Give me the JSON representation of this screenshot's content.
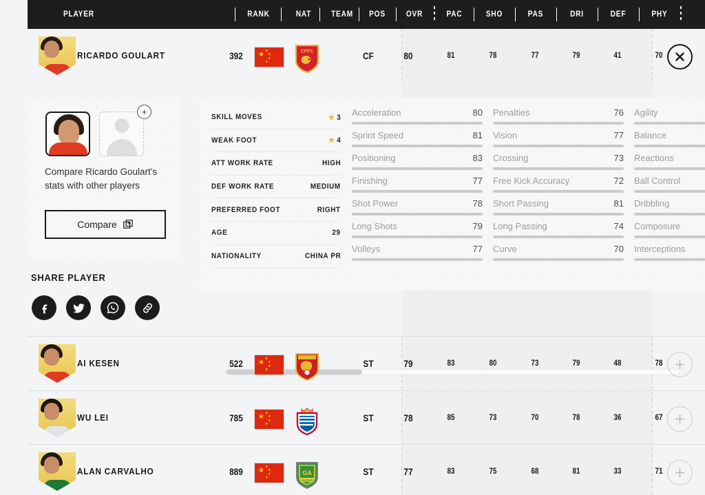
{
  "table": {
    "columns": [
      {
        "key": "player",
        "label": "PLAYER"
      },
      {
        "key": "rank",
        "label": "RANK"
      },
      {
        "key": "nat",
        "label": "NAT"
      },
      {
        "key": "team",
        "label": "TEAM"
      },
      {
        "key": "pos",
        "label": "POS"
      },
      {
        "key": "ovr",
        "label": "OVR"
      },
      {
        "key": "pac",
        "label": "PAC"
      },
      {
        "key": "sho",
        "label": "SHO"
      },
      {
        "key": "pas",
        "label": "PAS"
      },
      {
        "key": "dri",
        "label": "DRI"
      },
      {
        "key": "def",
        "label": "DEF"
      },
      {
        "key": "phy",
        "label": "PHY"
      }
    ]
  },
  "selected_player": {
    "name": "RICARDO GOULART",
    "rank": "392",
    "nation": "China PR",
    "nation_flag": "china-flag",
    "team": "Hebei CFFC",
    "team_badge": "hebei-cffc-badge",
    "pos": "CF",
    "ovr": "80",
    "pac": "81",
    "sho": "78",
    "pas": "77",
    "dri": "79",
    "def": "41",
    "phy": "70",
    "close_label": "✕"
  },
  "detail": {
    "compare_card": {
      "description": "Compare Ricardo Goulart's stats with other players",
      "button_label": "Compare",
      "add_slot_label": "+"
    },
    "share": {
      "title": "SHARE PLAYER",
      "icons": [
        {
          "name": "facebook-icon",
          "glyph": "f"
        },
        {
          "name": "twitter-icon",
          "glyph": "t"
        },
        {
          "name": "whatsapp-icon",
          "glyph": "w"
        },
        {
          "name": "copy-link-icon",
          "glyph": "l"
        }
      ]
    },
    "info_rows": [
      {
        "label": "SKILL MOVES",
        "value": "3",
        "star": true
      },
      {
        "label": "WEAK FOOT",
        "value": "4",
        "star": true
      },
      {
        "label": "ATT WORK RATE",
        "value": "HIGH",
        "star": false
      },
      {
        "label": "DEF WORK RATE",
        "value": "MEDIUM",
        "star": false
      },
      {
        "label": "PREFERRED FOOT",
        "value": "RIGHT",
        "star": false
      },
      {
        "label": "AGE",
        "value": "29",
        "star": false
      },
      {
        "label": "NATIONALITY",
        "value": "CHINA PR",
        "star": false
      }
    ],
    "stat_columns": [
      {
        "rows": [
          {
            "name": "Acceleration",
            "value": "80",
            "pct": 80,
            "color": "#4caf3f"
          },
          {
            "name": "Sprint Speed",
            "value": "81",
            "pct": 81,
            "color": "#4caf3f"
          },
          {
            "name": "Positioning",
            "value": "83",
            "pct": 83,
            "color": "#4caf3f"
          },
          {
            "name": "Finishing",
            "value": "77",
            "pct": 77,
            "color": "#4caf3f"
          },
          {
            "name": "Shot Power",
            "value": "78",
            "pct": 78,
            "color": "#4caf3f"
          },
          {
            "name": "Long Shots",
            "value": "79",
            "pct": 79,
            "color": "#4caf3f"
          },
          {
            "name": "Volleys",
            "value": "77",
            "pct": 77,
            "color": "#4caf3f"
          }
        ]
      },
      {
        "rows": [
          {
            "name": "Penalties",
            "value": "76",
            "pct": 76,
            "color": "#4caf3f"
          },
          {
            "name": "Vision",
            "value": "77",
            "pct": 77,
            "color": "#4caf3f"
          },
          {
            "name": "Crossing",
            "value": "73",
            "pct": 73,
            "color": "#4caf3f"
          },
          {
            "name": "Free Kick Accuracy",
            "value": "72",
            "pct": 72,
            "color": "#4caf3f"
          },
          {
            "name": "Short Passing",
            "value": "81",
            "pct": 81,
            "color": "#4caf3f"
          },
          {
            "name": "Long Passing",
            "value": "74",
            "pct": 74,
            "color": "#4caf3f"
          },
          {
            "name": "Curve",
            "value": "70",
            "pct": 70,
            "color": "#e8c444"
          }
        ]
      },
      {
        "rows": [
          {
            "name": "Agility",
            "value": "",
            "pct": 100,
            "color": "#4caf3f"
          },
          {
            "name": "Balance",
            "value": "",
            "pct": 100,
            "color": "#4caf3f"
          },
          {
            "name": "Reactions",
            "value": "",
            "pct": 100,
            "color": "#4caf3f"
          },
          {
            "name": "Ball Control",
            "value": "",
            "pct": 100,
            "color": "#4caf3f"
          },
          {
            "name": "Dribbling",
            "value": "",
            "pct": 100,
            "color": "#4caf3f"
          },
          {
            "name": "Composure",
            "value": "",
            "pct": 100,
            "color": "#4caf3f"
          },
          {
            "name": "Interceptions",
            "value": "",
            "pct": 55,
            "color": "#e5342b"
          }
        ]
      }
    ],
    "scroll_thumb_pct": 30
  },
  "player_rows": [
    {
      "name": "AI KESEN",
      "rank": "522",
      "nation_flag": "china-flag",
      "team_badge": "guangzhou-evergrande-badge",
      "pos": "ST",
      "ovr": "79",
      "pac": "83",
      "sho": "80",
      "pas": "73",
      "dri": "79",
      "def": "48",
      "phy": "78",
      "add_label": "+",
      "hair": "#241a12",
      "kit": "#e03a22"
    },
    {
      "name": "WU LEI",
      "rank": "785",
      "nation_flag": "china-flag",
      "team_badge": "espanyol-badge",
      "pos": "ST",
      "ovr": "78",
      "pac": "85",
      "sho": "73",
      "pas": "70",
      "dri": "78",
      "def": "36",
      "phy": "67",
      "add_label": "+",
      "hair": "#1b1410",
      "kit": "#dfe4ea"
    },
    {
      "name": "ALAN CARVALHO",
      "rank": "889",
      "nation_flag": "china-flag",
      "team_badge": "beijing-guoan-badge",
      "pos": "ST",
      "ovr": "77",
      "pac": "83",
      "sho": "75",
      "pas": "68",
      "dri": "81",
      "def": "33",
      "phy": "71",
      "add_label": "+",
      "hair": "#231a13",
      "kit": "#1f7a3a"
    }
  ],
  "colors": {
    "header_bg": "#1d1d1d",
    "green": "#4caf3f",
    "yellow": "#e8c444",
    "red": "#e5342b",
    "gold_card": "#e9c44e"
  }
}
